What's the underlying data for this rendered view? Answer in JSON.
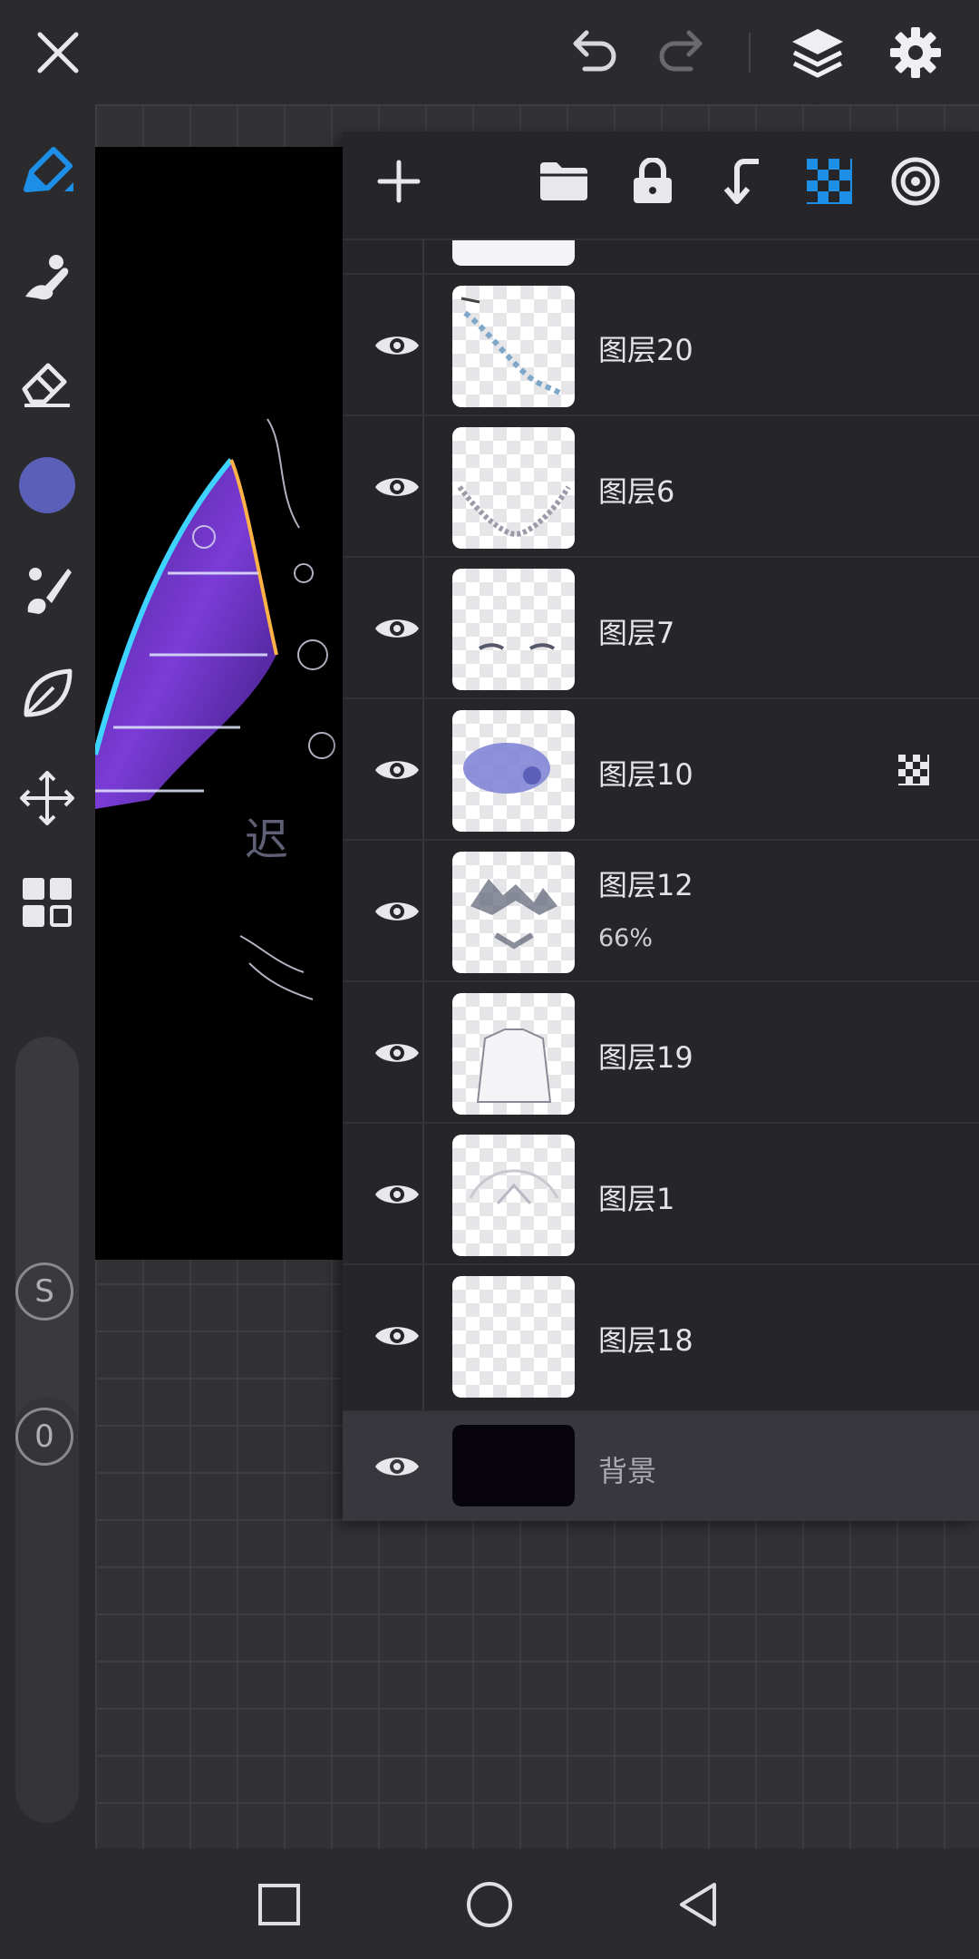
{
  "header": {
    "close_icon": "close-icon",
    "undo_icon": "undo-icon",
    "redo_icon": "redo-icon",
    "layers_icon": "layers-icon",
    "settings_icon": "gear-icon"
  },
  "tools": [
    "pen-icon",
    "smudge-icon",
    "eraser-icon",
    "color-swatch",
    "brush-icon",
    "leaf-icon",
    "move-icon",
    "grid-icon"
  ],
  "colors": {
    "accent": "#1e8fe6",
    "current_color": "#5b5fb8",
    "panel_bg": "#262529"
  },
  "sliders": {
    "size_label": "S",
    "opacity_label": "0"
  },
  "layers_panel": {
    "toolbar": [
      "add-layer-icon",
      "folder-icon",
      "lock-icon",
      "merge-down-icon",
      "alpha-lock-icon",
      "blend-icon"
    ],
    "layers": [
      {
        "name": "图层20",
        "opacity": "",
        "clipping": false
      },
      {
        "name": "图层6",
        "opacity": "",
        "clipping": false
      },
      {
        "name": "图层7",
        "opacity": "",
        "clipping": false
      },
      {
        "name": "图层10",
        "opacity": "",
        "clipping": true
      },
      {
        "name": "图层12",
        "opacity": "66%",
        "clipping": false
      },
      {
        "name": "图层19",
        "opacity": "",
        "clipping": false
      },
      {
        "name": "图层1",
        "opacity": "",
        "clipping": false
      },
      {
        "name": "图层18",
        "opacity": "",
        "clipping": false
      }
    ],
    "background": {
      "name": "背景"
    }
  },
  "navbar": [
    "recent-apps-icon",
    "home-icon",
    "back-icon"
  ]
}
